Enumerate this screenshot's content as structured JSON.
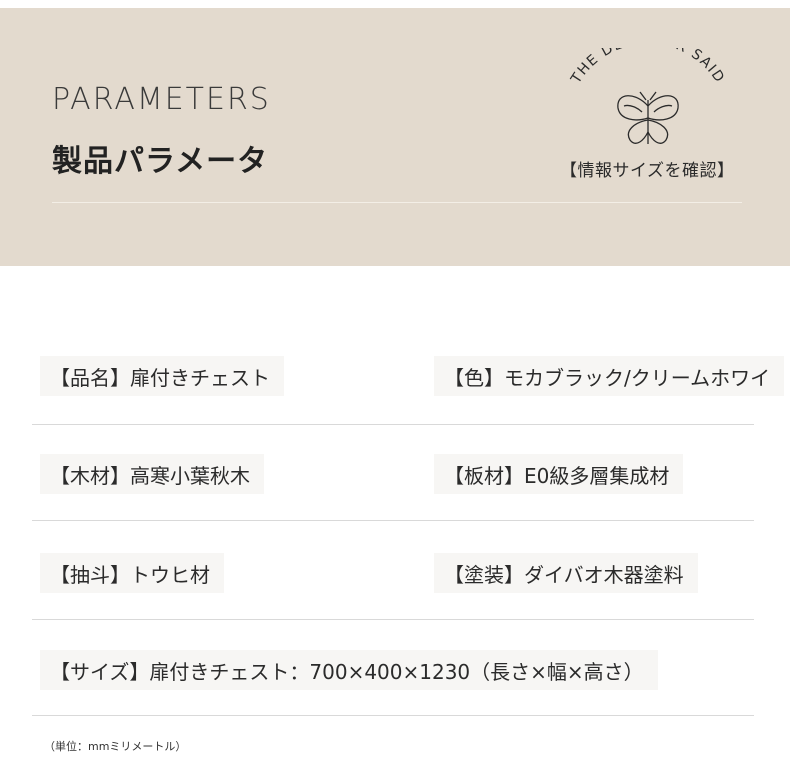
{
  "header": {
    "title_en": "PARAMETERS",
    "title_jp": "製品パラメータ",
    "badge": {
      "arc_text": "THE DESIGNER SAID",
      "icon": "butterfly-icon",
      "link_label": "【情報サイズを確認】"
    }
  },
  "params": {
    "product_name": "【品名】扉付きチェスト",
    "color": "【色】モカブラック/クリームホワイ",
    "wood": "【木材】高寒小葉秋木",
    "board": "【板材】E0級多層集成材",
    "drawer": "【抽斗】トウヒ材",
    "paint": "【塗装】ダイバオ木器塗料",
    "size": "【サイズ】扉付きチェスト：700×400×1230（長さ×幅×高さ）"
  },
  "footer_note": "（単位：mmミリメートル）",
  "colors": {
    "header_bg": "#e3dace",
    "divider": "#d9d9d9",
    "cell_bg": "#f7f6f4",
    "text": "#2b2b2b"
  }
}
